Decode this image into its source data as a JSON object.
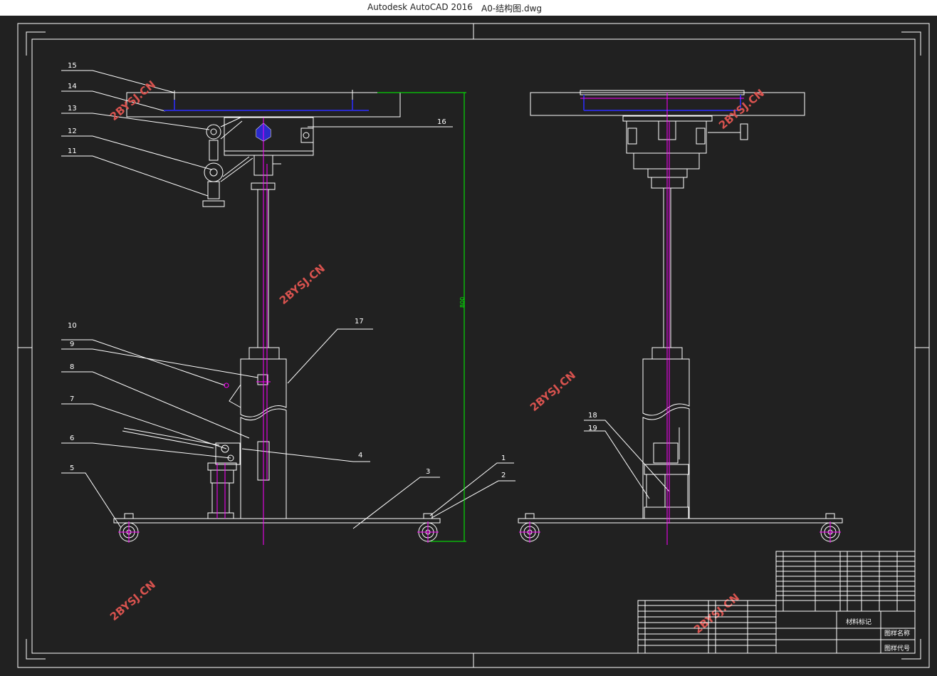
{
  "window": {
    "app_title": "Autodesk AutoCAD 2016",
    "file_name": "A0-结构图.dwg"
  },
  "drawing": {
    "callouts": [
      "1",
      "2",
      "3",
      "4",
      "5",
      "6",
      "7",
      "8",
      "9",
      "10",
      "11",
      "12",
      "13",
      "14",
      "15",
      "16",
      "17",
      "18",
      "19"
    ],
    "watermark": "2BYSJ.CN",
    "height_dimension": "800"
  },
  "title_block": {
    "material_mark": "材料标记",
    "drawing_name": "图样名称",
    "drawing_code": "图样代号"
  },
  "colors": {
    "background": "#212121",
    "line": "#ffffff",
    "centerline": "#ff00ff",
    "hidden": "#2020c0",
    "dimension": "#00ff00",
    "watermark": "#d9534f"
  }
}
